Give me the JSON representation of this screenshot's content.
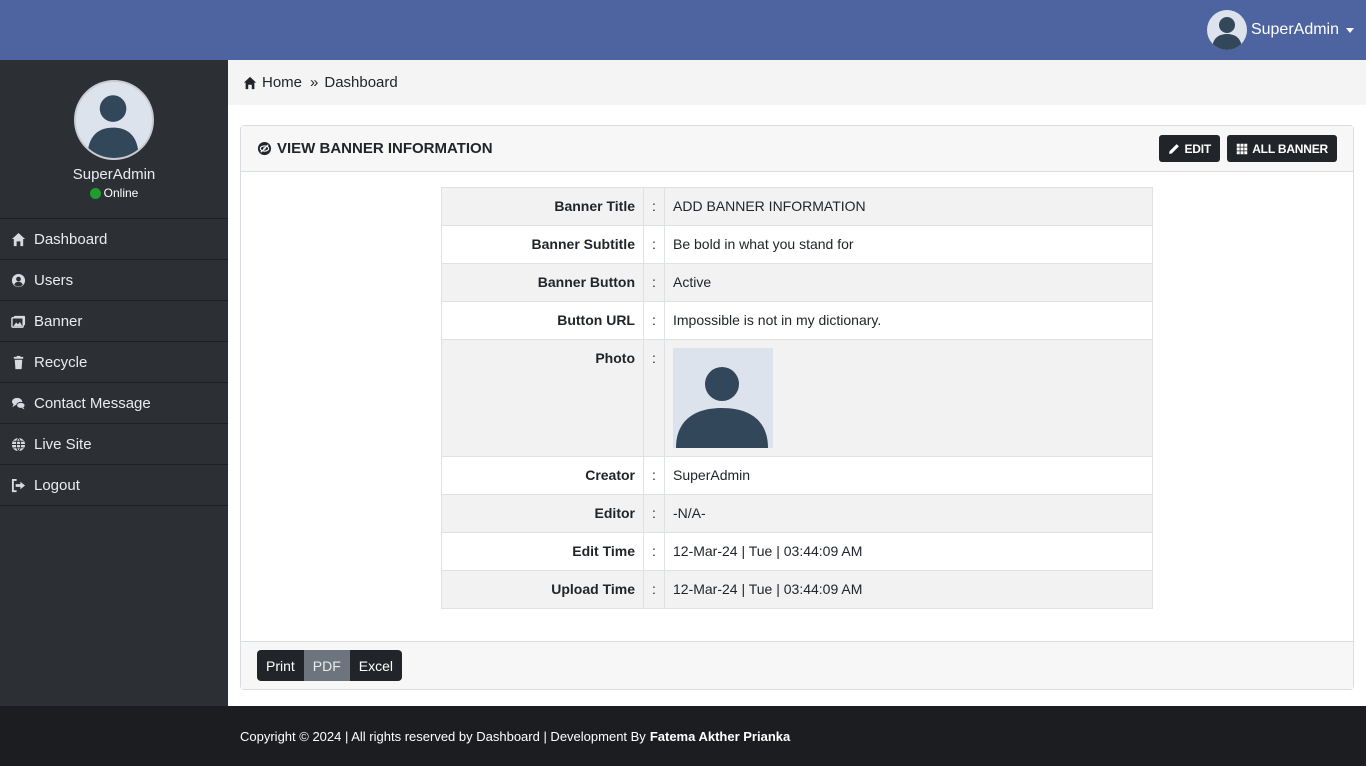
{
  "topbar": {
    "user_name": "SuperAdmin"
  },
  "sidebar": {
    "profile_name": "SuperAdmin",
    "status": "Online",
    "items": [
      {
        "label": "Dashboard",
        "icon": "home-icon"
      },
      {
        "label": "Users",
        "icon": "user-circle-icon"
      },
      {
        "label": "Banner",
        "icon": "images-icon"
      },
      {
        "label": "Recycle",
        "icon": "trash-icon"
      },
      {
        "label": "Contact Message",
        "icon": "comments-icon"
      },
      {
        "label": "Live Site",
        "icon": "globe-icon"
      },
      {
        "label": "Logout",
        "icon": "sign-out-icon"
      }
    ]
  },
  "breadcrumb": {
    "home": "Home",
    "current": "Dashboard"
  },
  "card": {
    "title": "VIEW BANNER INFORMATION",
    "edit_label": "EDIT",
    "all_label": "ALL BANNER",
    "rows": [
      {
        "label": "Banner Title",
        "value": "ADD BANNER INFORMATION"
      },
      {
        "label": "Banner Subtitle",
        "value": "Be bold in what you stand for"
      },
      {
        "label": "Banner Button",
        "value": "Active"
      },
      {
        "label": "Button URL",
        "value": "Impossible is not in my dictionary."
      },
      {
        "label": "Photo",
        "value": ""
      },
      {
        "label": "Creator",
        "value": "SuperAdmin"
      },
      {
        "label": "Editor",
        "value": "-N/A-"
      },
      {
        "label": "Edit Time",
        "value": "12-Mar-24 | Tue | 03:44:09 AM"
      },
      {
        "label": "Upload Time",
        "value": "12-Mar-24 | Tue | 03:44:09 AM"
      }
    ],
    "colon": ":",
    "export": {
      "print": "Print",
      "pdf": "PDF",
      "excel": "Excel"
    }
  },
  "footer": {
    "text": "Copyright © 2024 | All rights reserved by Dashboard | Development By",
    "author": "Fatema Akther Prianka"
  },
  "colors": {
    "topbar": "#4e64a0",
    "sidebar": "#2c3035",
    "status_online": "#1f9d2f",
    "footer": "#1b1d20"
  }
}
